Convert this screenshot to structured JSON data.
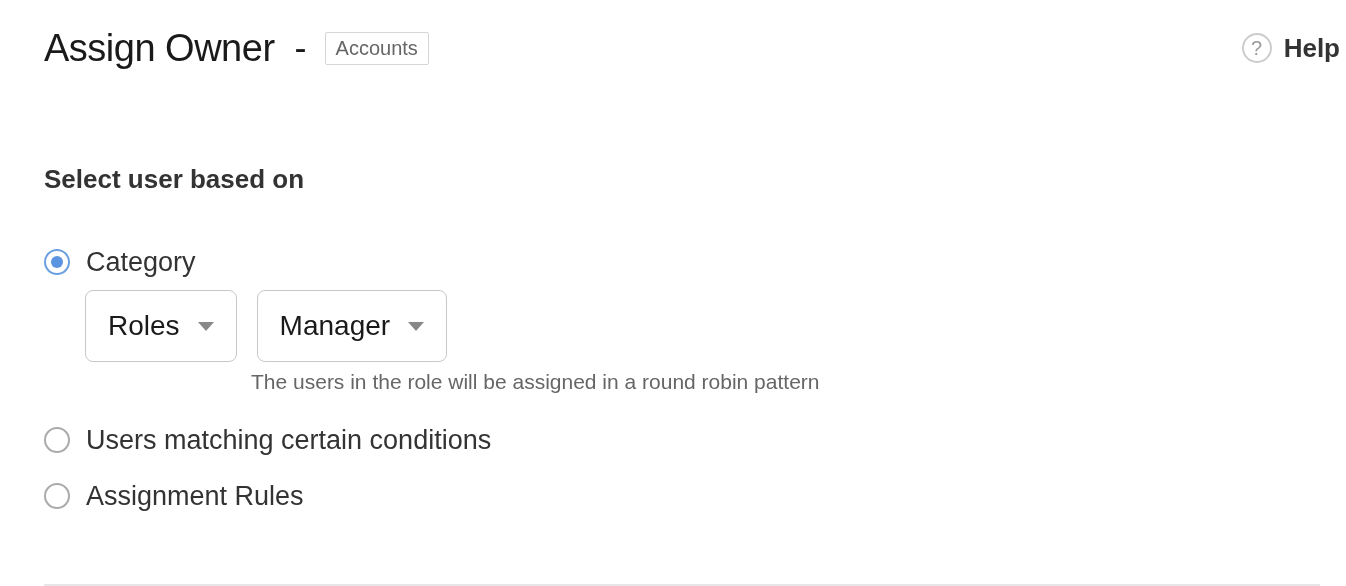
{
  "header": {
    "title": "Assign Owner",
    "separator": "-",
    "module_tag": "Accounts",
    "help": {
      "icon_glyph": "?",
      "label": "Help"
    }
  },
  "section_title": "Select user based on",
  "options": [
    {
      "label": "Category",
      "selected": true,
      "dropdowns": [
        {
          "value": "Roles"
        },
        {
          "value": "Manager"
        }
      ],
      "hint": "The users in the role will be assigned in a round robin pattern"
    },
    {
      "label": "Users matching certain conditions",
      "selected": false
    },
    {
      "label": "Assignment Rules",
      "selected": false
    }
  ]
}
